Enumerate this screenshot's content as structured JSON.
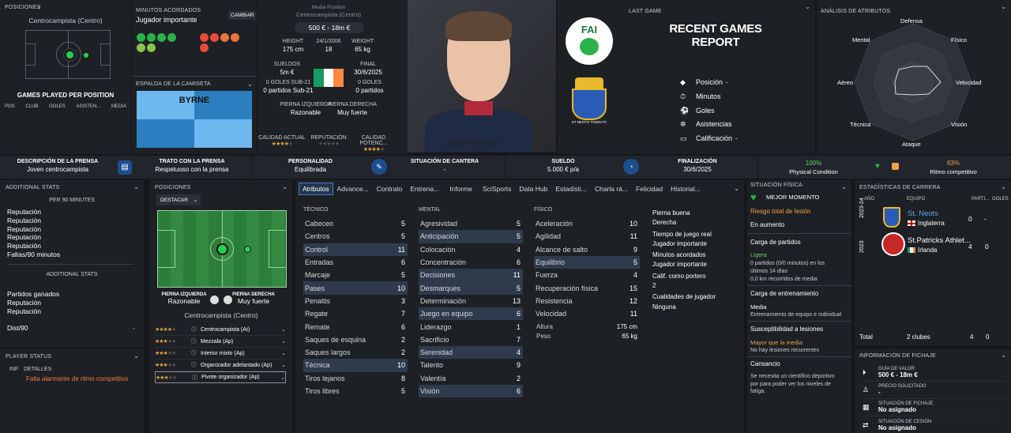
{
  "top": {
    "positions_header": "Posiciones",
    "position_label": "Centrocampista (Centro)",
    "games_per_position": "GAMES PLAYED PER POSITION",
    "gpp_cols": [
      "POS",
      "CLUB",
      "GOLES",
      "ASISTEN...",
      "MEDIA"
    ],
    "minutes_header": "Minutos acordados",
    "minutes_value": "Jugador importante",
    "change_button": "CAMBIAR",
    "shirt_header": "Espalda de la camiseta",
    "shirt_name": "BYRNE",
    "position_title": "Media Position",
    "position_role": "Centrocampista (Centro)",
    "value_range": "500 € - 18m €",
    "height_label": "HEIGHT",
    "height_value": "175 cm",
    "dob": "24/1/2006",
    "age": "18",
    "weight_label": "WEIGHT",
    "weight_value": "65 kg",
    "wages_label": "SUELDOS",
    "wages_value": "5m €",
    "final_label": "FINAL",
    "final_value": "30/6/2025",
    "u21_goals_label": "0 GOLES SUB-21",
    "u21_games": "0 partidos Sub-21",
    "goals_label": "0 GOLES",
    "games": "0 partidos",
    "left_foot_label": "PIERNA IZQUIERDA",
    "left_foot_value": "Razonable",
    "right_foot_label": "PIERNA DERECHA",
    "right_foot_value": "Muy fuerte",
    "current_ability_label": "CALIDAD ACTUAL",
    "reputation_label": "REPUTACIÓN",
    "potential_label": "CALIDAD POTENC...",
    "signature": "James Byrne",
    "last_game_label": "LAST GAME",
    "recent_report": "RECENT GAMES REPORT",
    "recent_dash": "-",
    "recent_items": [
      {
        "label": "Posición",
        "val": "-"
      },
      {
        "label": "Minutos",
        "val": ""
      },
      {
        "label": "Goles",
        "val": ""
      },
      {
        "label": "Asistencias",
        "val": ""
      },
      {
        "label": "Calificación",
        "val": "-"
      }
    ],
    "fai_text": "FAI",
    "club_crest_text": "ST NEOTS TOWN FC",
    "attr_analysis": "Análisis de atributos",
    "radar_labels": [
      "Defensa",
      "Físico",
      "Velocidad",
      "Visión",
      "Ataque",
      "Técnica",
      "Aéreo",
      "Mental"
    ]
  },
  "info": [
    {
      "l1": "DESCRIPCIÓN DE LA PRENSA",
      "v1": "Joven centrocampista",
      "l2": "TRATO CON LA PRENSA",
      "v2": "Respetuoso con la prensa"
    },
    {
      "l1": "PERSONALIDAD",
      "v1": "Equilibrada",
      "l2": "SITUACIÓN DE CANTERA",
      "v2": "-"
    },
    {
      "l1": "SUELDO",
      "v1": "5.000 € p/a",
      "l2": "FINALIZACIÓN",
      "v2": "30/6/2025"
    }
  ],
  "condition": {
    "pct": "100%",
    "label": "Physical Condition",
    "pct2": "63%",
    "label2": "Ritmo competitivo"
  },
  "additional": {
    "header": "Additional Stats",
    "per90": "PER 90 MINUTES",
    "rows": [
      "Reputación",
      "Reputación",
      "Reputación",
      "Reputación",
      "Reputación",
      "Faltas/90 minutos"
    ],
    "header2": "ADDITIONAL STATS",
    "rows2": [
      "Partidos ganados",
      "Reputación",
      "Reputación"
    ],
    "dist_label": "Dist/90",
    "dist_val": "-"
  },
  "player_status": {
    "header": "Player Status",
    "col1": "INF",
    "col2": "DETALLES",
    "text": "Falta alarmante de ritmo competitivo"
  },
  "posiciones": {
    "header": "Posiciones",
    "dropdown": "DESTACAR",
    "left_label": "PIERNA IZQUIERDA",
    "left_val": "Razonable",
    "right_label": "PIERNA DERECHA",
    "right_val": "Muy fuerte",
    "role": "Centrocampista (Centro)",
    "roles": [
      {
        "stars": "★★★★",
        "gray": "★",
        "name": "Centrocampista (At)"
      },
      {
        "stars": "★★★",
        "gray": "★★",
        "name": "Mezzala (Ap)"
      },
      {
        "stars": "★★★",
        "gray": "★★",
        "name": "Interior mixto (Ap)"
      },
      {
        "stars": "★★★",
        "gray": "★★",
        "name": "Organizador adelantado (Ap)"
      },
      {
        "stars": "★★★",
        "gray": "★★",
        "name": "Pivote organizador (Ap)"
      }
    ]
  },
  "tabs": [
    "Atributos",
    "Advance...",
    "Contrato",
    "Entrena...",
    "Informe",
    "SciSports",
    "Data Hub",
    "Estadísti...",
    "Charla rá...",
    "Felicidad",
    "Historial..."
  ],
  "tecnico": {
    "title": "TÉCNICO",
    "rows": [
      [
        "Cabeceo",
        "5"
      ],
      [
        "Centros",
        "5"
      ],
      [
        "Control",
        "11"
      ],
      [
        "Entradas",
        "6"
      ],
      [
        "Marcaje",
        "5"
      ],
      [
        "Pases",
        "10"
      ],
      [
        "Penaltis",
        "3"
      ],
      [
        "Regate",
        "7"
      ],
      [
        "Remate",
        "6"
      ],
      [
        "Saques de esquina",
        "2"
      ],
      [
        "Saques largos",
        "2"
      ],
      [
        "Técnica",
        "10"
      ],
      [
        "Tiros lejanos",
        "8"
      ],
      [
        "Tiros libres",
        "5"
      ]
    ]
  },
  "mental": {
    "title": "MENTAL",
    "rows": [
      [
        "Agresividad",
        "5"
      ],
      [
        "Anticipación",
        "5"
      ],
      [
        "Colocación",
        "4"
      ],
      [
        "Concentración",
        "6"
      ],
      [
        "Decisiones",
        "11"
      ],
      [
        "Desmarques",
        "5"
      ],
      [
        "Determinación",
        "13"
      ],
      [
        "Juego en equipo",
        "6"
      ],
      [
        "Liderazgo",
        "1"
      ],
      [
        "Sacrificio",
        "7"
      ],
      [
        "Serenidad",
        "4"
      ],
      [
        "Talento",
        "9"
      ],
      [
        "Valentía",
        "2"
      ],
      [
        "Visión",
        "6"
      ]
    ]
  },
  "fisico": {
    "title": "FÍSICO",
    "rows": [
      [
        "Aceleración",
        "10"
      ],
      [
        "Agilidad",
        "11"
      ],
      [
        "Alcance de salto",
        "9"
      ],
      [
        "Equilibrio",
        "5"
      ],
      [
        "Fuerza",
        "4"
      ],
      [
        "Recuperación física",
        "15"
      ],
      [
        "Resistencia",
        "12"
      ],
      [
        "Velocidad",
        "11"
      ]
    ],
    "height_label": "Altura",
    "height": "175 cm",
    "weight_label": "Peso",
    "weight": "65 kg"
  },
  "extra": [
    "Pierna buena",
    "Derecha",
    "Tiempo de juego real",
    "Jugador importante",
    "Minutos acordados",
    "Jugador importante",
    "Calif. como portero",
    "2",
    "Cualidades de jugador",
    "Ninguna"
  ],
  "fisica": {
    "header": "Situación física",
    "mood": "MEJOR MOMENTO",
    "risk": "Riesgo total de lesión",
    "risk_val": "En aumento",
    "load": "Carga de partidos",
    "load_val": "Ligera",
    "load_desc": "0 partidos (0/0 minutos) en los últimos 14 días",
    "km": "0,0 km recorridos de media",
    "train": "Carga de entrenamiento",
    "train_val": "Media",
    "train_desc": "Entrenamiento de equipo e individual",
    "susc": "Susceptibilidad a lesiones",
    "susc_val": "Mayor que la media",
    "susc_desc": "No hay lesiones recurrentes",
    "fatigue": "Cansancio",
    "fatigue_desc": "Se necesita un científico deportivo por para poder ver los niveles de fatiga."
  },
  "career": {
    "header": "Estadísticas de carrera",
    "cols": [
      "AÑO",
      "EQUIPO",
      "PARTI...",
      "GOLES"
    ],
    "rows": [
      {
        "year": "2023-24",
        "team": "St. Neots",
        "country": "Inglaterra",
        "games": "0",
        "goals": "-"
      },
      {
        "year": "2023",
        "team": "St.Patricks Athlet...",
        "country": "Irlanda",
        "games": "4",
        "goals": "0"
      }
    ],
    "total_label": "Total",
    "total_clubs": "2 clubes",
    "total_games": "4",
    "total_goals": "0"
  },
  "transfer": {
    "header": "Información de fichaje",
    "items": [
      {
        "label": "GUÍA DE VALOR",
        "val": "500 € - 18m €"
      },
      {
        "label": "PRECIO SOLICITADO",
        "val": "-"
      },
      {
        "label": "SITUACIÓN DE FICHAJE",
        "val": "No asignado"
      },
      {
        "label": "SITUACIÓN DE CESIÓN",
        "val": "No asignado"
      }
    ]
  }
}
